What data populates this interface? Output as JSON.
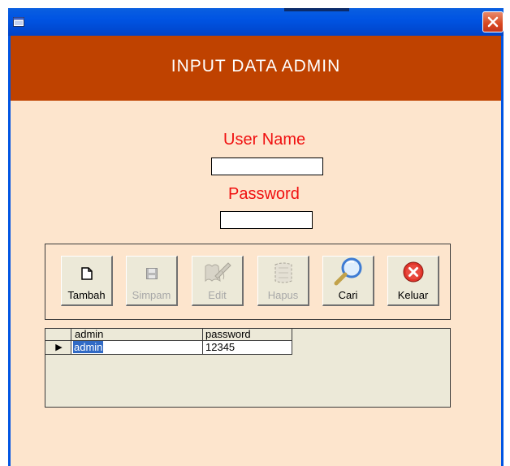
{
  "window": {
    "icon": "app-icon",
    "close_icon": "close-icon"
  },
  "header": {
    "title": "INPUT DATA ADMIN"
  },
  "form": {
    "username_label": "User Name",
    "username_value": "",
    "password_label": "Password",
    "password_value": ""
  },
  "toolbar": {
    "buttons": [
      {
        "label": "Tambah",
        "icon": "new-document-icon",
        "enabled": true
      },
      {
        "label": "Simpam",
        "icon": "save-icon",
        "enabled": false
      },
      {
        "label": "Edit",
        "icon": "edit-icon",
        "enabled": false
      },
      {
        "label": "Hapus",
        "icon": "delete-icon",
        "enabled": false
      },
      {
        "label": "Cari",
        "icon": "search-icon",
        "enabled": true
      },
      {
        "label": "Keluar",
        "icon": "exit-icon",
        "enabled": true
      }
    ]
  },
  "grid": {
    "columns": [
      "admin",
      "password"
    ],
    "rows": [
      [
        "admin",
        "12345"
      ]
    ],
    "current_row_indicator": "▶"
  },
  "colors": {
    "title_bar": "#0054e3",
    "header_band": "#bf4200",
    "form_background": "#fde5cd",
    "label_red": "#f01010"
  }
}
